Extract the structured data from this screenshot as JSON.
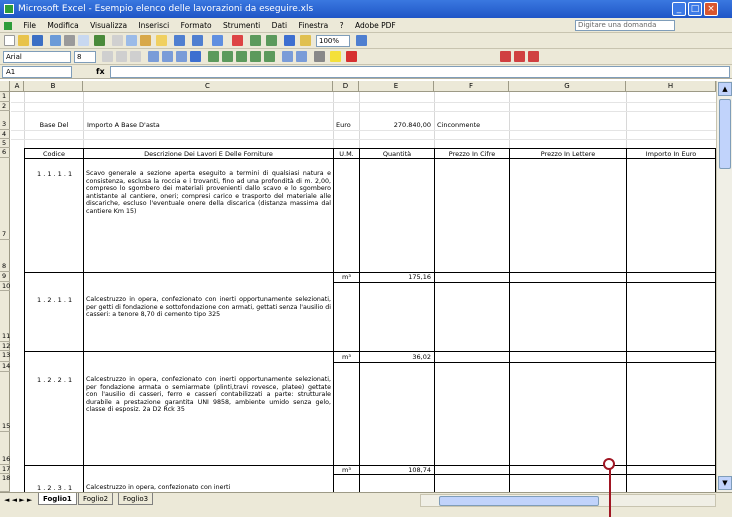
{
  "window": {
    "title": "Microsoft Excel - Esempio elenco delle lavorazioni da eseguire.xls",
    "controls": [
      "_",
      "□",
      "×"
    ]
  },
  "menubar": {
    "items": [
      "File",
      "Modifica",
      "Visualizza",
      "Inserisci",
      "Formato",
      "Strumenti",
      "Dati",
      "Finestra",
      "?",
      "Adobe PDF"
    ],
    "help_placeholder": "Digitare una domanda"
  },
  "toolbar": {
    "font_name": "Arial",
    "font_size": "8",
    "zoom": "100%"
  },
  "formula_bar": {
    "name_box": "A1",
    "fx": "fx",
    "content": ""
  },
  "grid": {
    "columns": [
      "A",
      "B",
      "C",
      "D",
      "E",
      "F",
      "G",
      "H"
    ],
    "rows": [
      "1",
      "2",
      "3",
      "4",
      "5",
      "6",
      "7",
      "8",
      "9",
      "10",
      "11",
      "12",
      "13",
      "14",
      "15",
      "16",
      "17",
      "18"
    ]
  },
  "sheet": {
    "base_label": "Base Del",
    "base_text": "Importo A Base D'asta",
    "base_currency": "Euro",
    "base_amount": "270.840,00",
    "base_word": "Cinconmente",
    "headers": {
      "code": "Codice",
      "description": "Descrizione Dei Lavori E Delle Forniture",
      "unit": "U.M.",
      "quantity": "Quantità",
      "unit_price": "Prezzo In Cifre",
      "price_words": "Prezzo In Lettere",
      "amount": "Importo In Euro"
    },
    "items": [
      {
        "code": "1 . 1 . 1 . 1",
        "description": "Scavo generale a sezione aperta eseguito a termini di qualsiasi natura e consistenza, esclusa la roccia e i trovanti, fino ad una profondità di m. 2,00, compreso lo sgombero dei materiali provenienti dallo scavo e lo sgombero antistante al cantiere, oneri; compresi carico e trasporto del materiale alle discariche, escluso l'eventuale onere della discarica (distanza massima dal cantiere Km 15)",
        "unit": "m³",
        "quantity": "175,16"
      },
      {
        "code": "1 . 2 . 1 . 1",
        "description": "Calcestruzzo in opera, confezionato con inerti opportunamente selezionati, per getti di fondazione e sottofondazione con armati, gettati senza l'ausilio di casseri: a tenore 8,70 di cemento tipo 325",
        "unit": "m³",
        "quantity": "36,02"
      },
      {
        "code": "1 . 2 . 2 . 1",
        "description": "Calcestruzzo in opera, confezionato con inerti opportunamente selezionati, per fondazione armata o semiarmate (plinti,travi rovesce, platee) gettate con l'ausilio di casseri, ferro e casseri contabilizzati a parte: strutturale durabile a prestazione garantita UNI 9858, ambiente umido senza gelo, classe di esposiz. 2a D2 Rck 35",
        "unit": "m³",
        "quantity": "108,74"
      },
      {
        "code": "1 . 2 . 3 . 1",
        "description": "Calcestruzzo in opera, confezionato con inerti",
        "unit": "",
        "quantity": ""
      }
    ]
  },
  "sheet_tabs": [
    "Foglio1",
    "Foglio2",
    "Foglio3"
  ],
  "tab_nav": "◄ ◄ ► ►",
  "colors": {
    "titlebar": "#1f55c6",
    "chrome": "#ece9d8",
    "callout": "#a01623"
  }
}
